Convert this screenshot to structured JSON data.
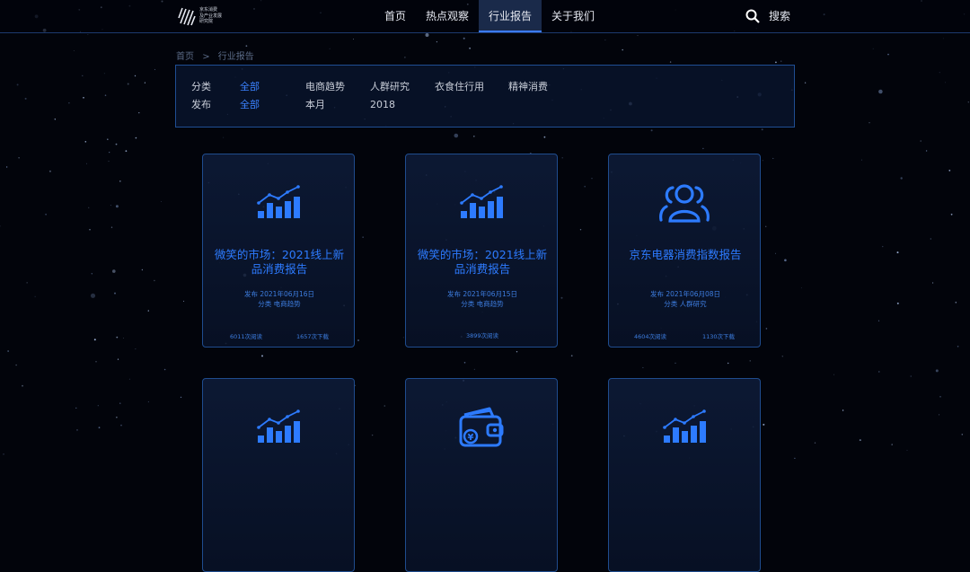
{
  "header": {
    "logo_text": "京东消费\n及产业发展\n研究院",
    "nav": [
      "首页",
      "热点观察",
      "行业报告",
      "关于我们"
    ],
    "active_nav": 2,
    "search_label": "搜索"
  },
  "breadcrumb": [
    "首页",
    ">",
    "行业报告"
  ],
  "filters": {
    "category": {
      "label": "分类",
      "options": [
        "全部",
        "电商趋势",
        "人群研究",
        "衣食住行用",
        "精神消费"
      ],
      "active": 0
    },
    "publish": {
      "label": "发布",
      "options": [
        "全部",
        "本月",
        "2018"
      ],
      "active": 0
    }
  },
  "cards": [
    {
      "icon": "bar-chart-icon",
      "title": "微笑的市场：2021线上新品消费报告",
      "date": "发布 2021年06月16日",
      "category": "分类 电商趋势",
      "reads": "6011次阅读",
      "downloads": "1657次下载"
    },
    {
      "icon": "bar-chart-icon",
      "title": "微笑的市场：2021线上新品消费报告",
      "date": "发布 2021年06月15日",
      "category": "分类 电商趋势",
      "reads": "3899次阅读",
      "downloads": ""
    },
    {
      "icon": "users-icon",
      "title": "京东电器消费指数报告",
      "date": "发布 2021年06月08日",
      "category": "分类 人群研究",
      "reads": "4604次阅读",
      "downloads": "1130次下载"
    },
    {
      "icon": "bar-chart-icon",
      "title": "",
      "date": "",
      "category": "",
      "reads": "",
      "downloads": ""
    },
    {
      "icon": "wallet-icon",
      "title": "",
      "date": "",
      "category": "",
      "reads": "",
      "downloads": ""
    },
    {
      "icon": "bar-chart-icon",
      "title": "",
      "date": "",
      "category": "",
      "reads": "",
      "downloads": ""
    }
  ],
  "colors": {
    "accent": "#3b82ff",
    "border": "#1f4c8e",
    "background": "#02040b"
  }
}
